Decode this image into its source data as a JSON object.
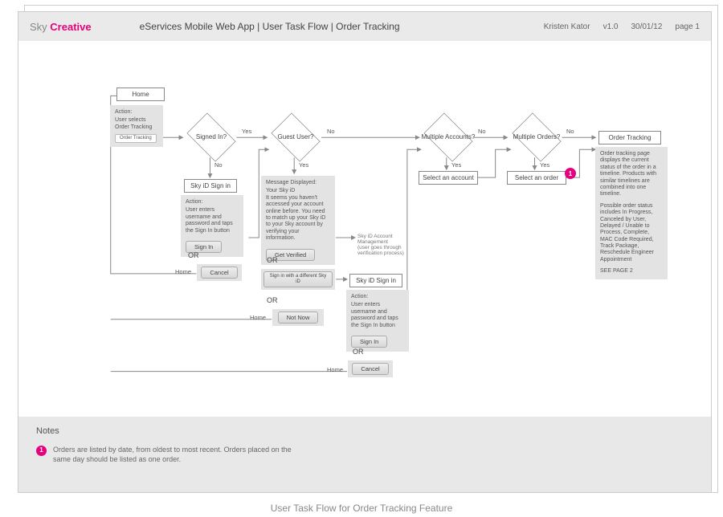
{
  "header": {
    "logo_pre": "Sky",
    "logo_bold": "Creative",
    "title": "eServices Mobile Web App  |  User Task Flow  |  Order Tracking",
    "author": "Kristen Kator",
    "version": "v1.0",
    "date": "30/01/12",
    "page": "page 1"
  },
  "flow": {
    "home": "Home",
    "home_action_hdr": "Action:",
    "home_action_txt": "User selects Order Tracking",
    "home_btn": "Order Tracking",
    "signed_in": "Signed In?",
    "yes": "Yes",
    "no": "No",
    "guest_user": "Guest User?",
    "multi_acct": "Multiple Accounts?",
    "multi_orders": "Multiple Orders?",
    "order_tracking": "Order Tracking",
    "order_tracking_desc": "Order tracking page displays the current status of the order in a timeline. Products with similar timelines are combined into one timeline.",
    "order_tracking_desc2": "Possible order status includes In Progress, Canceled by User, Delayed / Unable to Process, Complete, MAC Code Required, Track Package, Reschedule Engineer Appointment",
    "see_page2": "SEE PAGE 2",
    "select_account": "Select an account",
    "select_order": "Select an order",
    "sky_id_signin": "Sky iD Sign in",
    "signin_action_hdr": "Action:",
    "signin_action_txt": "User enters username and password and taps the Sign In button",
    "signin_btn": "Sign In",
    "or": "OR",
    "cancel": "Cancel",
    "home_label": "Home",
    "guest_msg_hdr": "Message Displayed:",
    "guest_msg_txt": "Your Sky iD\nIt seems you haven't accessed your account online before. You need to match up your Sky iD to your Sky account by verifying your information.",
    "get_verified": "Get Verified",
    "sky_id_mgmt": "Sky iD Account Management\n(user goes through verification process)",
    "signin_diff": "Sign in with a different Sky iD",
    "not_now": "Not Now",
    "sky_id_signin2": "Sky iD Sign in",
    "signin2_action_hdr": "Action:",
    "signin2_action_txt": "User enters username and password and taps the Sign In button",
    "signin2_btn": "Sign In",
    "cancel2": "Cancel"
  },
  "notes": {
    "heading": "Notes",
    "n1": "Orders are listed by date, from oldest to most recent.  Orders placed on the same day should be listed as one order."
  },
  "caption": "User Task Flow for Order Tracking Feature"
}
